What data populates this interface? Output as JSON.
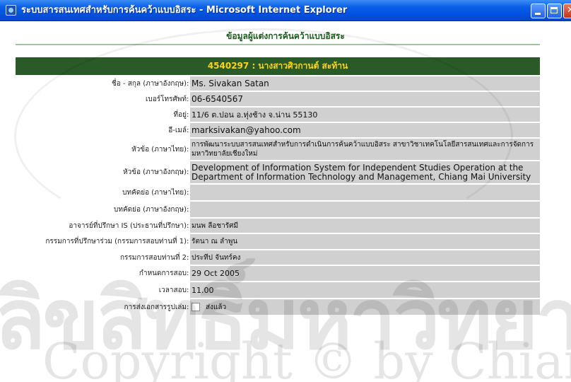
{
  "window": {
    "title": "ระบบสารสนเทศสำหรับการค้นคว้าแบบอิสระ - Microsoft Internet Explorer"
  },
  "page": {
    "heading": "ข้อมูลผู้แต่งการค้นคว้าแบบอิสระ",
    "student_header": "4540297 : นางสาวศิวกานต์ สะท้าน"
  },
  "fields": [
    {
      "label": "ชื่อ - สกุล (ภาษาอังกฤษ)",
      "value": "Ms. Sivakan Satan"
    },
    {
      "label": "เบอร์โทรศัพท์",
      "value": "06-6540567"
    },
    {
      "label": "ที่อยู่",
      "value": "11/6 ต.ปอน อ.ทุ่งช้าง จ.น่าน 55130"
    },
    {
      "label": "อี-เมล์",
      "value": "marksivakan@yahoo.com"
    },
    {
      "label": "หัวข้อ (ภาษาไทย)",
      "value": "การพัฒนาระบบสารสนเทศสำหรับการดำเนินการค้นคว้าแบบอิสระ สาขาวิชาเทคโนโลยีสารสนเทศและการจัดการ มหาวิทยาลัยเชียงใหม่"
    },
    {
      "label": "หัวข้อ (ภาษาอังกฤษ)",
      "value": "Development of Information System for Independent Studies Operation at the Department of Information Technology and Management, Chiang Mai University"
    },
    {
      "label": "บทคัดย่อ (ภาษาไทย)",
      "value": ""
    },
    {
      "label": "บทคัดย่อ (ภาษาอังกฤษ)",
      "value": ""
    },
    {
      "label": "อาจารย์ที่ปรึกษา IS (ประธานที่ปรึกษา)",
      "value": "มนพ ลือชารัศมี"
    },
    {
      "label": "กรรมการที่ปรึกษาร่วม (กรรมการสอบท่านที่ 1)",
      "value": "รัตนา ณ ลำพูน"
    },
    {
      "label": "กรรมการสอบท่านที่ 2",
      "value": "ประทีป จันทร์คง"
    },
    {
      "label": "กำหนดการสอบ",
      "value": "29 Oct 2005"
    },
    {
      "label": "เวลาสอบ",
      "value": "11.00"
    },
    {
      "label": "การส่งเอกสารรูปเล่ม",
      "value": "ส่งแล้ว"
    }
  ],
  "watermark": {
    "thai": "ลิขสิทธิ์มหาวิทยาลัยเชียงใหม่",
    "copyright": "Copyright © by Chiang Mai University"
  },
  "colors": {
    "header_bg": "#295a27",
    "header_text": "#ffd21a",
    "value_bg": "#d0d0d0"
  }
}
